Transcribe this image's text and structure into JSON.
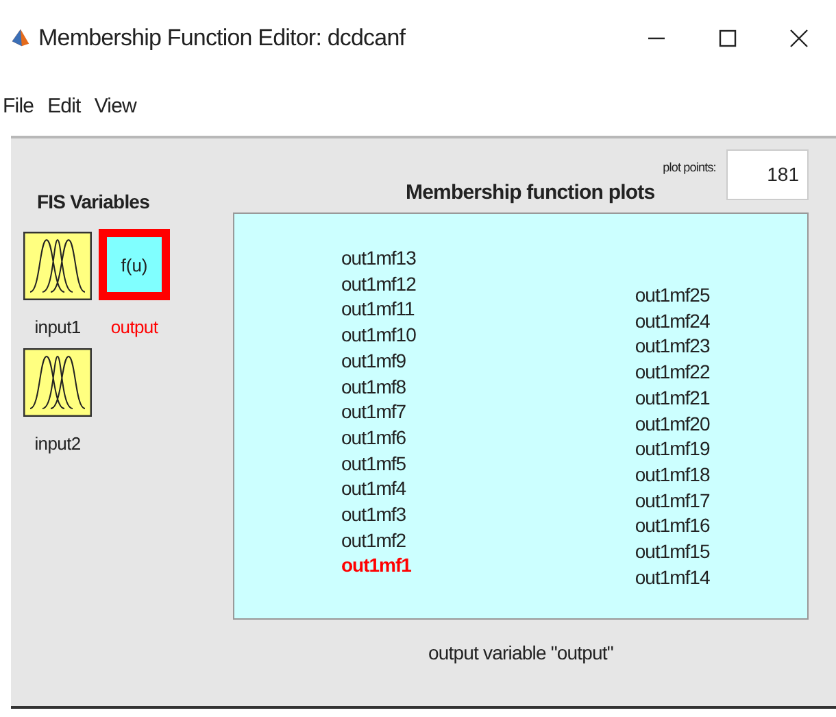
{
  "window": {
    "title": "Membership Function Editor: dcdcanf"
  },
  "menu": [
    "File",
    "Edit",
    "View"
  ],
  "fis_variables": {
    "title": "FIS Variables",
    "items": [
      {
        "name": "input1",
        "kind": "input",
        "selected": false
      },
      {
        "name": "output",
        "kind": "output",
        "selected": true,
        "icon_text": "f(u)"
      },
      {
        "name": "input2",
        "kind": "input",
        "selected": false
      }
    ]
  },
  "plot": {
    "title": "Membership function plots",
    "plot_points_label": "plot points:",
    "plot_points": "181",
    "left_column": [
      {
        "label": "out1mf13",
        "selected": false
      },
      {
        "label": "out1mf12",
        "selected": false
      },
      {
        "label": "out1mf11",
        "selected": false
      },
      {
        "label": "out1mf10",
        "selected": false
      },
      {
        "label": "out1mf9",
        "selected": false
      },
      {
        "label": "out1mf8",
        "selected": false
      },
      {
        "label": "out1mf7",
        "selected": false
      },
      {
        "label": "out1mf6",
        "selected": false
      },
      {
        "label": "out1mf5",
        "selected": false
      },
      {
        "label": "out1mf4",
        "selected": false
      },
      {
        "label": "out1mf3",
        "selected": false
      },
      {
        "label": "out1mf2",
        "selected": false
      },
      {
        "label": "out1mf1",
        "selected": true
      }
    ],
    "right_column": [
      {
        "label": "out1mf25",
        "selected": false
      },
      {
        "label": "out1mf24",
        "selected": false
      },
      {
        "label": "out1mf23",
        "selected": false
      },
      {
        "label": "out1mf22",
        "selected": false
      },
      {
        "label": "out1mf21",
        "selected": false
      },
      {
        "label": "out1mf20",
        "selected": false
      },
      {
        "label": "out1mf19",
        "selected": false
      },
      {
        "label": "out1mf18",
        "selected": false
      },
      {
        "label": "out1mf17",
        "selected": false
      },
      {
        "label": "out1mf16",
        "selected": false
      },
      {
        "label": "out1mf15",
        "selected": false
      },
      {
        "label": "out1mf14",
        "selected": false
      }
    ],
    "caption": "output variable \"output\""
  }
}
